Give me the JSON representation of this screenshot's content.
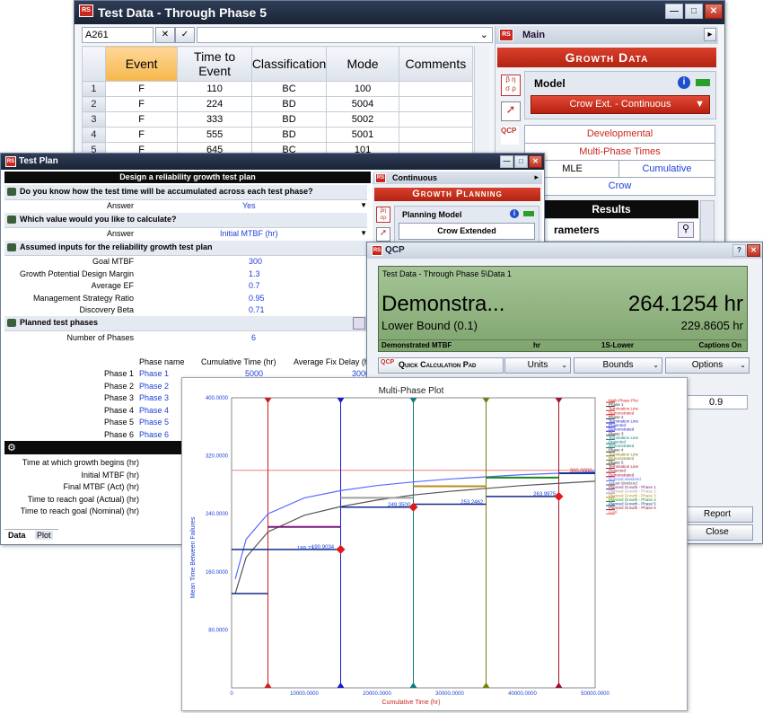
{
  "test_data": {
    "title": "Test Data - Through Phase 5",
    "cell_ref": "A261",
    "columns": [
      "Event",
      "Time to Event",
      "Classification",
      "Mode",
      "Comments"
    ],
    "rows": [
      {
        "n": "1",
        "event": "F",
        "time": "110",
        "cls": "BC",
        "mode": "100"
      },
      {
        "n": "2",
        "event": "F",
        "time": "224",
        "cls": "BD",
        "mode": "5004"
      },
      {
        "n": "3",
        "event": "F",
        "time": "333",
        "cls": "BD",
        "mode": "5002"
      },
      {
        "n": "4",
        "event": "F",
        "time": "555",
        "cls": "BD",
        "mode": "5001"
      },
      {
        "n": "5",
        "event": "F",
        "time": "645",
        "cls": "BC",
        "mode": "101"
      }
    ]
  },
  "main_panel": {
    "title": "Main",
    "banner": "Growth Data",
    "model_label": "Model",
    "model_value": "Crow Ext. - Continuous",
    "opt_developmental": "Developmental",
    "opt_multiphase": "Multi-Phase Times",
    "opt_mle": "MLE",
    "opt_cumulative": "Cumulative",
    "opt_crow": "Crow",
    "results": "Results",
    "parameters": "rameters"
  },
  "test_plan": {
    "title": "Test Plan",
    "header": "Design a reliability growth test plan",
    "q1": "Do you know how the test time will be accumulated across each test phase?",
    "answer_label": "Answer",
    "q1_answer": "Yes",
    "q2": "Which value would you like to calculate?",
    "q2_answer": "Initial MTBF (hr)",
    "inputs_header": "Assumed inputs for the reliability growth test plan",
    "inputs": [
      {
        "label": "Goal MTBF",
        "value": "300"
      },
      {
        "label": "Growth Potential Design Margin",
        "value": "1.3"
      },
      {
        "label": "Average EF",
        "value": "0.7"
      },
      {
        "label": "Management Strategy Ratio",
        "value": "0.95"
      },
      {
        "label": "Discovery Beta",
        "value": "0.71"
      }
    ],
    "phases_header": "Planned test phases",
    "num_phases_label": "Number of Phases",
    "num_phases": "6",
    "phase_cols": [
      "Phase name",
      "Cumulative Time (hr)",
      "Average Fix Delay (hr)"
    ],
    "phases": [
      {
        "label": "Phase 1",
        "name": "Phase 1",
        "cum": "5000",
        "delay": "3000"
      },
      {
        "label": "Phase 2",
        "name": "Phase 2",
        "cum": "",
        "delay": ""
      },
      {
        "label": "Phase 3",
        "name": "Phase 3",
        "cum": "",
        "delay": ""
      },
      {
        "label": "Phase 4",
        "name": "Phase 4",
        "cum": "",
        "delay": ""
      },
      {
        "label": "Phase 5",
        "name": "Phase 5",
        "cum": "",
        "delay": ""
      },
      {
        "label": "Phase 6",
        "name": "Phase 6",
        "cum": "",
        "delay": ""
      }
    ],
    "results": [
      "Time at which growth begins (hr)",
      "Initial MTBF (hr)",
      "Final MTBF (Act) (hr)",
      "Time to reach goal (Actual) (hr)",
      "Time to reach goal (Nominal) (hr)"
    ],
    "tab_data": "Data",
    "tab_plot": "Plot",
    "side_title": "Continuous",
    "side_banner": "Growth Planning",
    "planning_model_label": "Planning Model",
    "planning_model_value": "Crow Extended"
  },
  "qcp": {
    "title": "QCP",
    "path": "Test Data - Through Phase 5\\Data 1",
    "big_label": "Demonstra...",
    "big_value": "264.1254 hr",
    "lower_label": "Lower Bound (0.1)",
    "lower_value": "229.8605 hr",
    "footer_1": "Demonstrated MTBF",
    "footer_2": "hr",
    "footer_3": "1S-Lower",
    "footer_4": "Captions On",
    "quick_calc": "Quick Calculation Pad",
    "units": "Units",
    "bounds": "Bounds",
    "options": "Options",
    "field_value": "0.9",
    "report": "Report",
    "close": "Close"
  },
  "chart_data": {
    "type": "line",
    "title": "Multi-Phase Plot",
    "xlabel": "Cumulative Time (hr)",
    "ylabel": "Mean Time Between Failures",
    "xlim": [
      0,
      50000
    ],
    "ylim": [
      0,
      400
    ],
    "x_ticks": [
      "0",
      "10000.0000",
      "20000.0000",
      "30000.0000",
      "40000.0000",
      "50000.0000"
    ],
    "y_ticks": [
      "80.0000",
      "160.0000",
      "240.0000",
      "320.0000",
      "400.0000"
    ],
    "termination_lines": [
      5000,
      15000,
      25000,
      35000,
      45000
    ],
    "termination_colors": [
      "#d11a1a",
      "#1a1ad1",
      "#127a7a",
      "#7a7a12",
      "#a0122a"
    ],
    "goal": 300,
    "goal_label": "300.0000",
    "nominal_idealized": [
      [
        500,
        150
      ],
      [
        2000,
        205
      ],
      [
        5000,
        240
      ],
      [
        10000,
        262
      ],
      [
        15000,
        272
      ],
      [
        20000,
        279
      ],
      [
        25000,
        284
      ],
      [
        30000,
        288
      ],
      [
        35000,
        291
      ],
      [
        40000,
        294
      ],
      [
        45000,
        296
      ],
      [
        50000,
        298
      ]
    ],
    "actual_idealized": [
      [
        500,
        130
      ],
      [
        2000,
        180
      ],
      [
        5000,
        215
      ],
      [
        10000,
        238
      ],
      [
        15000,
        250
      ],
      [
        20000,
        259
      ],
      [
        25000,
        266
      ],
      [
        30000,
        271
      ],
      [
        35000,
        275
      ],
      [
        40000,
        279
      ],
      [
        45000,
        282
      ],
      [
        50000,
        285
      ]
    ],
    "demonstrated": [
      {
        "x0": 0,
        "x1": 5000,
        "y": 130
      },
      {
        "x0": 0,
        "x1": 15000,
        "y": 190.9
      },
      {
        "x0": 15000,
        "x1": 25000,
        "y": 249.3
      },
      {
        "x0": 25000,
        "x1": 35000,
        "y": 253.2
      },
      {
        "x0": 35000,
        "x1": 45000,
        "y": 263.9
      }
    ],
    "planned_growth": [
      {
        "x0": 5000,
        "x1": 15000,
        "y": 222,
        "color": "#7a1a7a"
      },
      {
        "x0": 15000,
        "x1": 25000,
        "y": 262,
        "color": "#a0a0a0"
      },
      {
        "x0": 25000,
        "x1": 35000,
        "y": 278,
        "color": "#c08a1a"
      },
      {
        "x0": 35000,
        "x1": 45000,
        "y": 290,
        "color": "#1a8a1a"
      },
      {
        "x0": 45000,
        "x1": 50000,
        "y": 296,
        "color": "#123a8a"
      }
    ],
    "demonstrated_points": [
      [
        15000,
        190.9
      ],
      [
        25000,
        249.3
      ],
      [
        45000,
        263.9
      ]
    ],
    "point_labels": [
      {
        "x": 11000,
        "y": 192,
        "text": "190.9034"
      },
      {
        "x": 9000,
        "y": 190,
        "text": "189.22"
      },
      {
        "x": 21500,
        "y": 250,
        "text": "249.3500"
      },
      {
        "x": 31500,
        "y": 254,
        "text": "253.2462"
      },
      {
        "x": 41500,
        "y": 265,
        "text": "263.9975"
      }
    ],
    "legend": [
      {
        "t": "Multi-Phase Plot",
        "c": "#d11a1a"
      },
      {
        "t": "Phase 1",
        "c": "#333"
      },
      {
        "t": "Termination Line",
        "c": "#d11a1a"
      },
      {
        "t": "Demonstrated",
        "c": "#d11a1a"
      },
      {
        "t": "Phase 2",
        "c": "#333"
      },
      {
        "t": "Termination Line",
        "c": "#1a1ad1"
      },
      {
        "t": "Projected",
        "c": "#1a1ad1"
      },
      {
        "t": "Demonstrated",
        "c": "#1a1ad1"
      },
      {
        "t": "Phase 3",
        "c": "#333"
      },
      {
        "t": "Termination Line",
        "c": "#127a7a"
      },
      {
        "t": "Projected",
        "c": "#127a7a"
      },
      {
        "t": "Demonstrated",
        "c": "#127a7a"
      },
      {
        "t": "Phase 4",
        "c": "#333"
      },
      {
        "t": "Termination Line",
        "c": "#7a7a12"
      },
      {
        "t": "Demonstrated",
        "c": "#7a7a12"
      },
      {
        "t": "Phase 5",
        "c": "#333"
      },
      {
        "t": "Termination Line",
        "c": "#a0122a"
      },
      {
        "t": "Projected",
        "c": "#a0122a"
      },
      {
        "t": "Demonstrated",
        "c": "#a0122a"
      },
      {
        "t": "Nominal Idealized",
        "c": "#5a6aff"
      },
      {
        "t": "Actual Idealized",
        "c": "#555"
      },
      {
        "t": "Planned Growth - Phase 1",
        "c": "#7a1a7a"
      },
      {
        "t": "Planned Growth - Phase 2",
        "c": "#a0a0a0"
      },
      {
        "t": "Planned Growth - Phase 3",
        "c": "#c08a1a"
      },
      {
        "t": "Planned Growth - Phase 4",
        "c": "#1a8a1a"
      },
      {
        "t": "Planned Growth - Phase 5",
        "c": "#123a8a"
      },
      {
        "t": "Planned Growth - Phase 6",
        "c": "#8a1a1a"
      },
      {
        "t": "Goal",
        "c": "#e05a5a"
      }
    ]
  },
  "colors": {
    "accent_red": "#c8281f",
    "title_bar": "#223049",
    "qcp_display": "#8fb07e"
  },
  "icons": [
    "rs-icon",
    "minimize-icon",
    "maximize-icon",
    "close-icon",
    "info-icon",
    "search-icon",
    "phase-icon",
    "qcp-icon"
  ]
}
